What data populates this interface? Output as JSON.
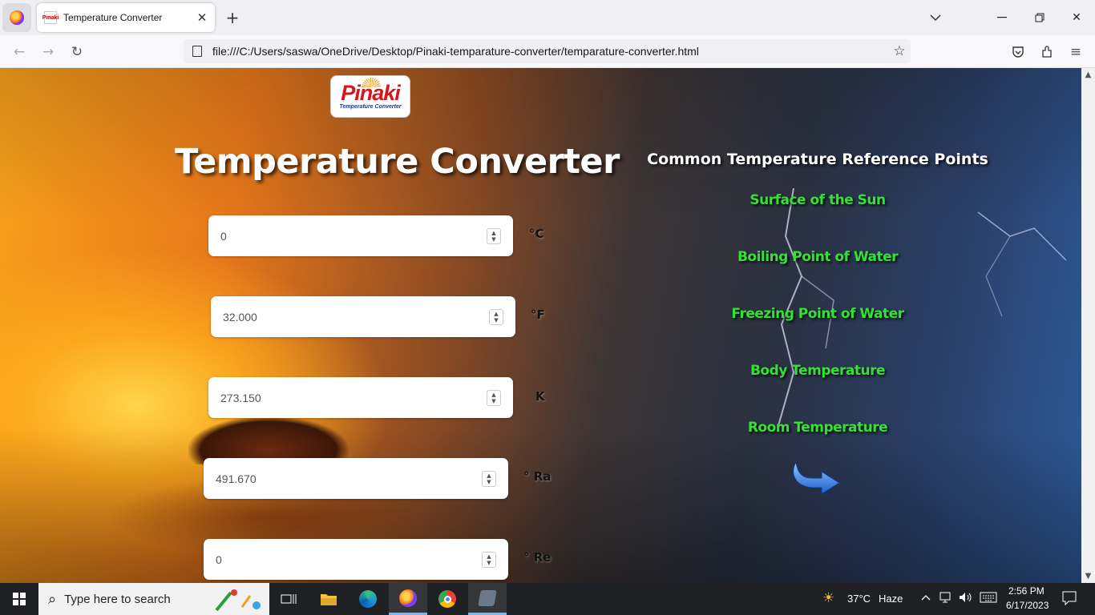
{
  "browser": {
    "tab_title": "Temperature Converter",
    "tab_favicon_text": "Pinaki",
    "url": "file:///C:/Users/saswa/OneDrive/Desktop/Pinaki-temparature-converter/temparature-converter.html"
  },
  "page": {
    "logo_text": "Pinaki",
    "logo_subtitle": "Temperature Converter",
    "title": "Temperature Converter",
    "fields": [
      {
        "value": "0",
        "unit": "°C"
      },
      {
        "value": "32.000",
        "unit": "°F"
      },
      {
        "value": "273.150",
        "unit": "K"
      },
      {
        "value": "491.670",
        "unit": "° Ra"
      },
      {
        "value": "0",
        "unit": "° Re"
      }
    ],
    "reference": {
      "title": "Common Temperature Reference Points",
      "items": [
        "Surface of the Sun",
        "Boiling Point of Water",
        "Freezing Point of Water",
        "Body Temperature",
        "Room Temperature"
      ]
    }
  },
  "taskbar": {
    "search_placeholder": "Type here to search",
    "weather_temp": "37°C",
    "weather_desc": "Haze",
    "time": "2:56 PM",
    "date": "6/17/2023"
  },
  "colors": {
    "reference_item": "#33e233",
    "taskbar_bg": "#1f2024",
    "active_indicator": "#76b9ed"
  },
  "icons": [
    "firefox-icon",
    "close-icon",
    "plus-icon",
    "chevron-down-icon",
    "minimize-icon",
    "restore-icon",
    "back-icon",
    "forward-icon",
    "reload-icon",
    "page-icon",
    "star-icon",
    "pocket-icon",
    "extensions-icon",
    "menu-icon",
    "curved-arrow-icon",
    "windows-icon",
    "search-icon",
    "task-view-icon",
    "file-explorer-icon",
    "edge-icon",
    "chrome-icon",
    "app-icon",
    "weather-icon",
    "chevron-up-icon",
    "network-icon",
    "volume-icon",
    "keyboard-icon",
    "notification-icon"
  ]
}
